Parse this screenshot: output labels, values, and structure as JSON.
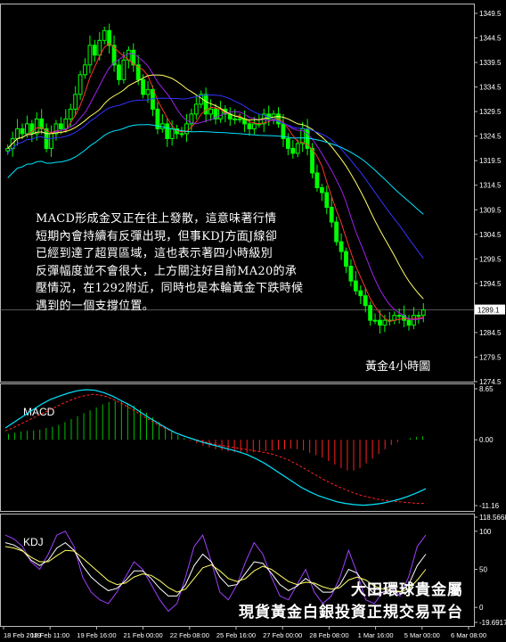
{
  "chart_data": [
    {
      "type": "candlestick",
      "panel": "price",
      "title": "黃金4小時圖",
      "x_ticks": [
        "18 Feb 2019",
        "18 Feb 11:00",
        "19 Feb 16:00",
        "21 Feb 00:00",
        "22 Feb 08:00",
        "25 Feb 16:00",
        "27 Feb 00:00",
        "28 Feb 08:00",
        "1 Mar 16:00",
        "5 Mar 00:00",
        "6 Mar 08:00"
      ],
      "y_ticks": [
        1349.5,
        1344.5,
        1339.5,
        1334.5,
        1329.5,
        1324.5,
        1319.5,
        1314.5,
        1309.5,
        1304.5,
        1299.5,
        1294.5,
        1289.5,
        1284.5,
        1279.5,
        1274.5
      ],
      "ylim": [
        1274.5,
        1351.5
      ],
      "current_price": "1289.1",
      "closes": [
        1322,
        1324,
        1326,
        1325,
        1327,
        1325,
        1328,
        1326,
        1322,
        1325,
        1327,
        1326,
        1328,
        1330,
        1333,
        1337,
        1339,
        1343,
        1341,
        1344,
        1346,
        1343,
        1339,
        1336,
        1340,
        1342,
        1339,
        1336,
        1333,
        1334,
        1330,
        1326,
        1327,
        1324,
        1326,
        1325,
        1325,
        1327,
        1329,
        1331,
        1333,
        1329,
        1330,
        1328,
        1330,
        1329,
        1328,
        1328,
        1328,
        1327,
        1326,
        1327,
        1327,
        1329,
        1328,
        1329,
        1327,
        1324,
        1322,
        1321,
        1323,
        1326,
        1322,
        1317,
        1314,
        1313,
        1310,
        1307,
        1303,
        1301,
        1298,
        1295,
        1293,
        1292,
        1290,
        1287,
        1287,
        1286,
        1287,
        1287,
        1288,
        1288,
        1287,
        1286,
        1288,
        1288,
        1289.1
      ]
    },
    {
      "type": "line",
      "panel": "MACD",
      "label": "MACD",
      "y_ticks": [
        "8.65",
        "0.00",
        "-11.16"
      ],
      "ylim": [
        -11.16,
        8.65
      ],
      "series": [
        {
          "role": "histogram",
          "values": [
            1.0,
            1.2,
            1.4,
            1.5,
            1.6,
            1.7,
            2.0,
            2.2,
            2.5,
            3.0,
            3.5,
            4.0,
            4.5,
            5.0,
            5.5,
            6.0,
            6.4,
            6.6,
            6.5,
            6.2,
            5.8,
            5.2,
            4.6,
            3.8,
            3.0,
            2.2,
            1.5,
            0.8,
            0.3,
            -0.2,
            -0.6,
            -1.0,
            -1.3,
            -1.6,
            -1.8,
            -2.0,
            -2.1,
            -2.2,
            -2.2,
            -2.1,
            -2.0,
            -1.9,
            -1.8,
            -1.7,
            -1.6,
            -1.5,
            -1.6,
            -1.8,
            -2.2,
            -2.6,
            -3.0,
            -3.6,
            -4.2,
            -4.8,
            -5.2,
            -5.2,
            -4.8,
            -4.0,
            -3.2,
            -2.4,
            -1.6,
            -0.9,
            -0.4,
            0.0,
            0.3,
            0.5,
            0.6
          ]
        },
        {
          "role": "signal",
          "values": [
            1.5,
            2.0,
            2.6,
            3.2,
            3.8,
            4.4,
            5.0,
            5.6,
            6.2,
            6.7,
            7.2,
            7.5,
            7.7,
            7.6,
            7.3,
            6.8,
            6.2,
            5.5,
            4.8,
            4.0,
            3.3,
            2.6,
            2.0,
            1.4,
            0.9,
            0.5,
            0.1,
            -0.2,
            -0.5,
            -0.8,
            -1.0,
            -1.2,
            -1.4,
            -1.6,
            -1.8,
            -2.0,
            -2.2,
            -2.5,
            -2.9,
            -3.4,
            -4.0,
            -4.7,
            -5.4,
            -6.1,
            -6.8,
            -7.4,
            -8.0,
            -8.5,
            -9.0,
            -9.4,
            -9.7,
            -10.0,
            -10.2,
            -10.4,
            -10.5,
            -10.6,
            -10.7,
            -10.8,
            -10.8
          ]
        },
        {
          "role": "macd",
          "values": [
            2.0,
            3.0,
            4.0,
            5.0,
            6.0,
            6.8,
            7.4,
            7.9,
            8.3,
            8.5,
            8.4,
            8.0,
            7.4,
            6.6,
            5.8,
            4.8,
            3.8,
            2.9,
            2.0,
            1.2,
            0.6,
            0.1,
            -0.4,
            -0.8,
            -1.2,
            -1.6,
            -2.0,
            -2.5,
            -3.2,
            -4.0,
            -5.0,
            -6.0,
            -7.0,
            -8.0,
            -8.8,
            -9.5,
            -10.0,
            -10.5,
            -10.8,
            -11.0,
            -11.1,
            -11.0,
            -10.8,
            -10.5,
            -10.1,
            -9.6,
            -9.0,
            -8.3
          ]
        }
      ]
    },
    {
      "type": "line",
      "panel": "KDJ",
      "label": "KDJ",
      "y_ticks": [
        "118.5668",
        "100",
        "50",
        "0",
        "-19.6917"
      ],
      "ylim": [
        -19.6917,
        118.5668
      ],
      "series": [
        {
          "role": "J",
          "values": [
            95,
            90,
            80,
            60,
            50,
            70,
            95,
            100,
            80,
            40,
            20,
            10,
            5,
            20,
            40,
            60,
            50,
            30,
            10,
            -5,
            5,
            40,
            80,
            95,
            60,
            20,
            10,
            30,
            60,
            85,
            70,
            40,
            15,
            10,
            30,
            50,
            20,
            5,
            15,
            40,
            75,
            45,
            10,
            5,
            20,
            25,
            15,
            40,
            80,
            95
          ]
        },
        {
          "role": "K",
          "values": [
            85,
            82,
            75,
            62,
            55,
            62,
            78,
            85,
            75,
            55,
            40,
            30,
            22,
            25,
            35,
            48,
            48,
            38,
            25,
            15,
            15,
            30,
            55,
            70,
            60,
            40,
            28,
            30,
            45,
            60,
            58,
            45,
            30,
            22,
            28,
            38,
            30,
            20,
            20,
            30,
            50,
            45,
            28,
            18,
            20,
            22,
            20,
            30,
            55,
            70
          ]
        },
        {
          "role": "D",
          "values": [
            80,
            78,
            74,
            66,
            60,
            60,
            68,
            75,
            74,
            65,
            55,
            45,
            35,
            30,
            32,
            40,
            44,
            42,
            35,
            26,
            20,
            24,
            38,
            52,
            56,
            48,
            38,
            34,
            38,
            48,
            54,
            50,
            42,
            34,
            30,
            33,
            32,
            27,
            24,
            26,
            36,
            40,
            36,
            28,
            24,
            22,
            21,
            24,
            36,
            50
          ]
        }
      ]
    }
  ],
  "commentary_lines": [
    "MACD形成金叉正在往上發散，這意味著行情",
    "短期內會持續有反彈出現，但事KDJ方面J線卻",
    "已經到達了超買區域，這也表示著四小時級別",
    "反彈幅度並不會很大，上方關注好目前MA20的承",
    "壓情況，在1292附近，同時也是本輪黃金下跌時候",
    "遇到的一個支撐位置。"
  ],
  "watermark": {
    "line1": "大田環球貴金屬",
    "line2": "現貨黃金白銀投資正規交易平台"
  },
  "colors": {
    "bull": "#00ff00",
    "bear": "#00ff00",
    "ma_fast": "#ff3333",
    "ma_mid": "#ffff66",
    "ma_slow": "#3333ff",
    "ma_long": "#00e5ff",
    "ma_purple": "#a020f0",
    "macd_hist_pos": "#00c000",
    "macd_hist_neg": "#ff2020",
    "macd_line": "#00e5ff",
    "macd_signal": "#ff2020",
    "kdj_j": "#a040ff",
    "kdj_k": "#ffffff",
    "kdj_d": "#ffff66"
  }
}
